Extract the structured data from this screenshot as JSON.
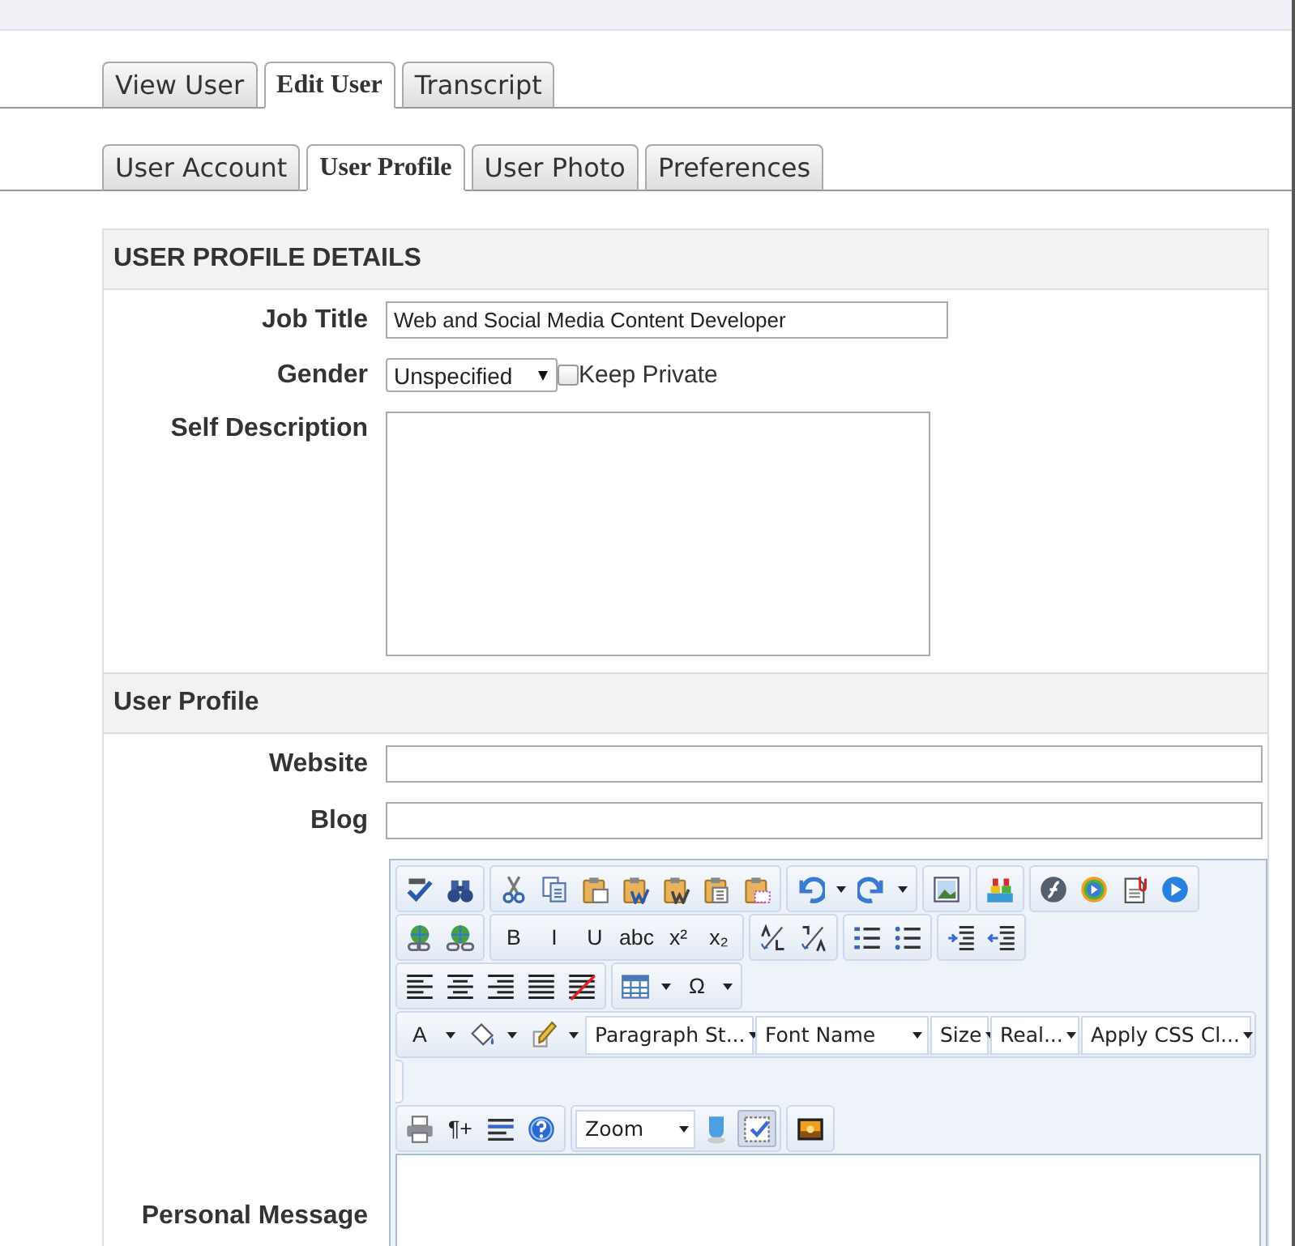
{
  "tabs": [
    {
      "label": "View User",
      "selected": false
    },
    {
      "label": "Edit User",
      "selected": true
    },
    {
      "label": "Transcript",
      "selected": false
    }
  ],
  "subtabs": [
    {
      "label": "User Account",
      "selected": false
    },
    {
      "label": "User Profile",
      "selected": true
    },
    {
      "label": "User Photo",
      "selected": false
    },
    {
      "label": "Preferences",
      "selected": false
    }
  ],
  "details": {
    "title": "USER PROFILE DETAILS",
    "job_title": {
      "label": "Job Title",
      "value": "Web and Social Media Content Developer"
    },
    "gender": {
      "label": "Gender",
      "value": "Unspecified",
      "keep_private": {
        "label": "Keep Private",
        "checked": false
      }
    },
    "self_description": {
      "label": "Self Description"
    }
  },
  "profile": {
    "title": "User Profile",
    "website": {
      "label": "Website"
    },
    "blog": {
      "label": "Blog"
    },
    "personal_message": {
      "label": "Personal Message",
      "toolbar_rows": [
        [
          [
            {
              "kind": "spell"
            },
            {
              "kind": "find"
            }
          ],
          [
            {
              "kind": "cut"
            },
            {
              "kind": "copy"
            },
            {
              "kind": "paste"
            },
            {
              "kind": "paste-word"
            },
            {
              "kind": "paste-clean"
            },
            {
              "kind": "paste-text"
            },
            {
              "kind": "paste-html"
            }
          ],
          [
            {
              "kind": "undo",
              "menu": true
            },
            {
              "kind": "redo",
              "menu": true
            }
          ],
          [
            {
              "kind": "image"
            }
          ],
          [
            {
              "kind": "blocks"
            }
          ],
          [
            {
              "kind": "flash"
            },
            {
              "kind": "media"
            },
            {
              "kind": "doc"
            },
            {
              "kind": "play"
            }
          ]
        ],
        [
          [
            {
              "kind": "link"
            },
            {
              "kind": "unlink"
            }
          ],
          [
            {
              "kind": "bold",
              "text": "B"
            },
            {
              "kind": "italic",
              "text": "I"
            },
            {
              "kind": "underline",
              "text": "U"
            },
            {
              "kind": "strike",
              "text": "abc"
            },
            {
              "kind": "sup",
              "text": "x²"
            },
            {
              "kind": "sub",
              "text": "x₂"
            }
          ],
          [
            {
              "kind": "case-up"
            },
            {
              "kind": "case-down"
            }
          ],
          [
            {
              "kind": "ol"
            },
            {
              "kind": "ul"
            }
          ],
          [
            {
              "kind": "outdent"
            },
            {
              "kind": "indent"
            }
          ]
        ],
        [
          [
            {
              "kind": "align-left"
            },
            {
              "kind": "align-center"
            },
            {
              "kind": "align-right"
            },
            {
              "kind": "justify"
            },
            {
              "kind": "clear"
            }
          ],
          [
            {
              "kind": "table",
              "menu": true
            },
            {
              "kind": "symbol",
              "text": "Ω",
              "menu": true
            }
          ]
        ],
        [
          [
            {
              "kind": "font-color",
              "text": "A",
              "menu": true
            },
            {
              "kind": "paint",
              "menu": true
            },
            {
              "kind": "brush",
              "menu": true
            },
            {
              "kind": "dropdown",
              "text": "Paragraph St..."
            },
            {
              "kind": "dropdown",
              "text": "Font Name"
            },
            {
              "kind": "dropdown",
              "text": "Size"
            },
            {
              "kind": "dropdown",
              "text": "Real..."
            },
            {
              "kind": "dropdown",
              "text": "Apply CSS Cl..."
            }
          ]
        ],
        [
          [
            {
              "kind": "print"
            },
            {
              "kind": "paragraph",
              "text": "¶+"
            },
            {
              "kind": "lines"
            },
            {
              "kind": "help"
            }
          ],
          [
            {
              "kind": "dropdown",
              "text": "Zoom"
            },
            {
              "kind": "mask",
              "selected": false
            },
            {
              "kind": "check",
              "selected": true
            }
          ],
          [
            {
              "kind": "picture"
            }
          ]
        ]
      ]
    }
  }
}
